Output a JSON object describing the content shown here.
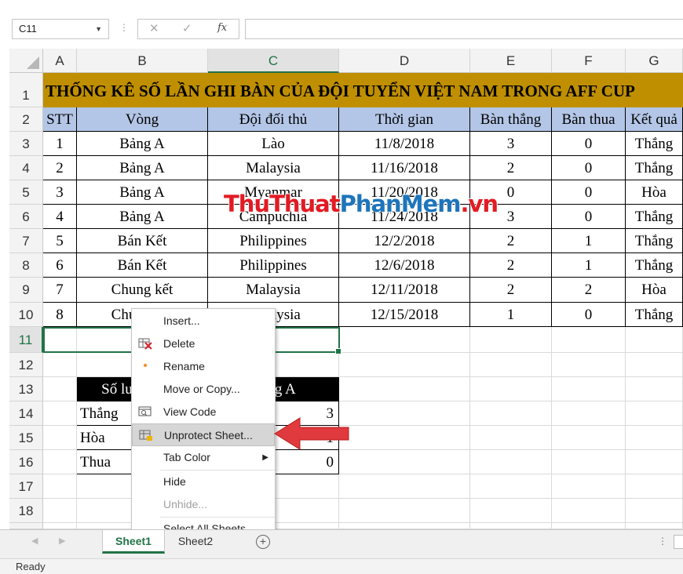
{
  "formula_bar": {
    "name_box": "C11",
    "formula": ""
  },
  "columns": [
    "A",
    "B",
    "C",
    "D",
    "E",
    "F",
    "G"
  ],
  "rows": [
    "1",
    "2",
    "3",
    "4",
    "5",
    "6",
    "7",
    "8",
    "9",
    "10",
    "11",
    "12",
    "13",
    "14",
    "15",
    "16",
    "17",
    "18"
  ],
  "sheet": {
    "title": "THỐNG KÊ SỐ LẦN GHI BÀN CỦA ĐỘI TUYỂN VIỆT NAM TRONG AFF CUP",
    "headers": [
      "STT",
      "Vòng",
      "Đội đối thủ",
      "Thời gian",
      "Bàn thắng",
      "Bàn thua",
      "Kết quả"
    ],
    "rows": [
      [
        "1",
        "Bảng A",
        "Lào",
        "11/8/2018",
        "3",
        "0",
        "Thắng"
      ],
      [
        "2",
        "Bảng A",
        "Malaysia",
        "11/16/2018",
        "2",
        "0",
        "Thắng"
      ],
      [
        "3",
        "Bảng A",
        "Myanmar",
        "11/20/2018",
        "0",
        "0",
        "Hòa"
      ],
      [
        "4",
        "Bảng A",
        "Campuchia",
        "11/24/2018",
        "3",
        "0",
        "Thắng"
      ],
      [
        "5",
        "Bán Kết",
        "Philippines",
        "12/2/2018",
        "2",
        "1",
        "Thắng"
      ],
      [
        "6",
        "Bán Kết",
        "Philippines",
        "12/6/2018",
        "2",
        "1",
        "Thắng"
      ],
      [
        "7",
        "Chung kết",
        "Malaysia",
        "12/11/2018",
        "2",
        "2",
        "Hòa"
      ],
      [
        "8",
        "Chung kết",
        "Malaysia",
        "12/15/2018",
        "1",
        "0",
        "Thắng"
      ]
    ],
    "summary": {
      "header_left": "Số lượng trận",
      "header_right": "Bảng A",
      "rows": [
        [
          "Thắng",
          "3"
        ],
        [
          "Hòa",
          "1"
        ],
        [
          "Thua",
          "0"
        ]
      ]
    }
  },
  "watermark": {
    "part1": "ThuThuat",
    "part2": "PhanMem",
    "part3": ".vn"
  },
  "context_menu": {
    "items": [
      {
        "label": "Insert...",
        "icon": "none"
      },
      {
        "label": "Delete",
        "icon": "delete-sheet-icon"
      },
      {
        "label": "Rename",
        "icon": "dot-icon"
      },
      {
        "label": "Move or Copy...",
        "icon": "none"
      },
      {
        "label": "View Code",
        "icon": "view-code-icon"
      },
      {
        "label": "Unprotect Sheet...",
        "icon": "unprotect-sheet-icon"
      },
      {
        "label": "Tab Color",
        "icon": "none"
      },
      {
        "label": "Hide",
        "icon": "none"
      },
      {
        "label": "Unhide...",
        "icon": "none"
      },
      {
        "label": "Select All Sheets",
        "icon": "none"
      }
    ]
  },
  "tabs": {
    "sheet1": "Sheet1",
    "sheet2": "Sheet2"
  },
  "status": {
    "text": "Ready"
  },
  "colors": {
    "accent": "#217346",
    "title_fill": "#bf8f00",
    "header_fill": "#b4c6e7",
    "arrow": "#e0393e"
  }
}
